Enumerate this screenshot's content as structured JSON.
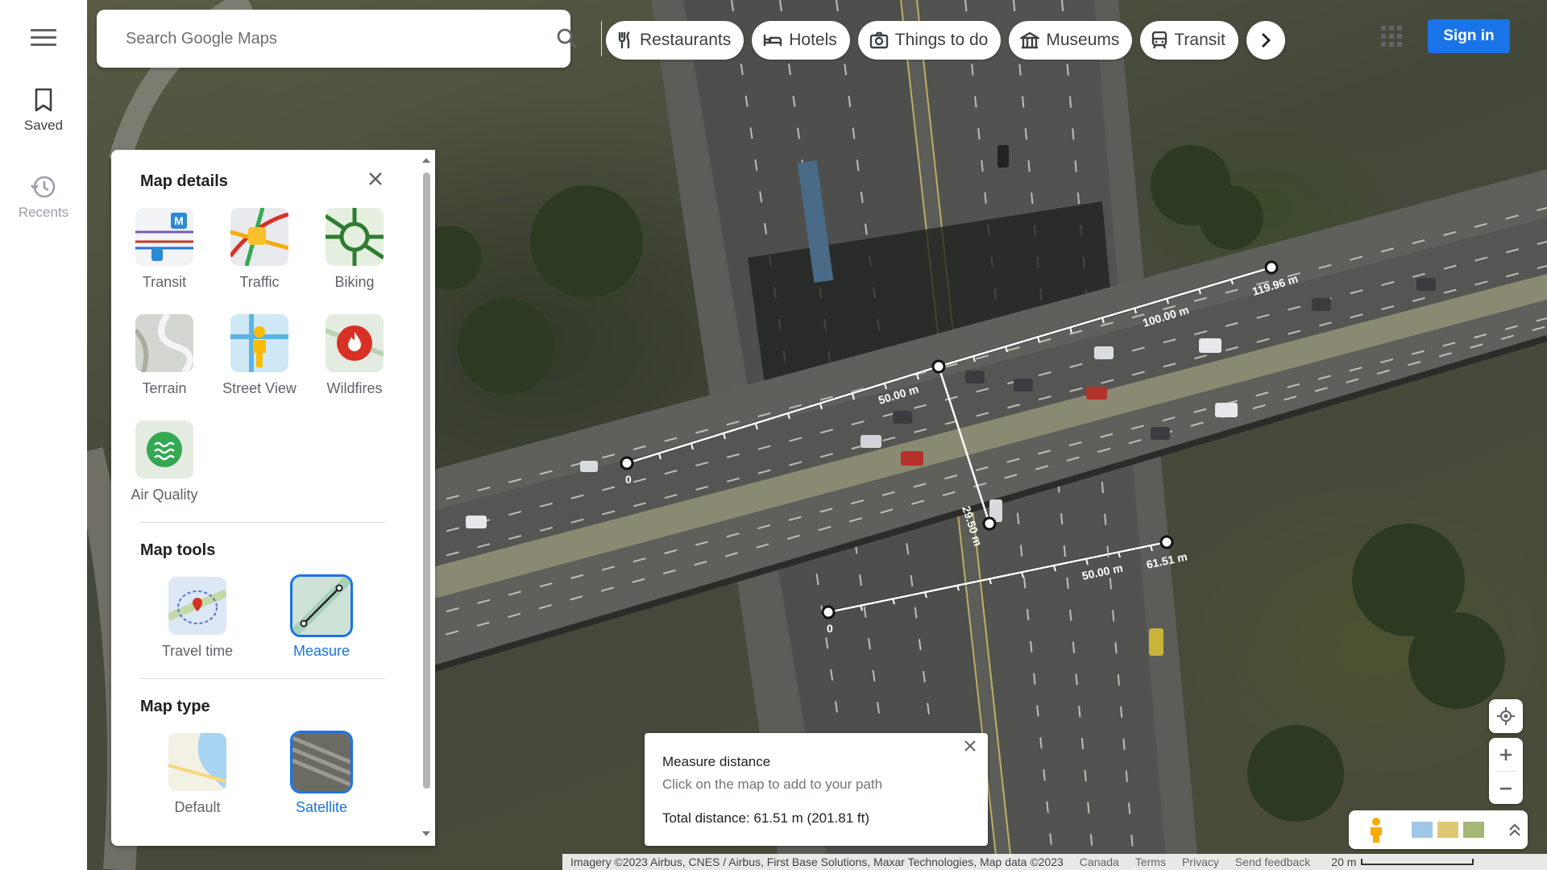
{
  "rail": {
    "saved_label": "Saved",
    "recents_label": "Recents"
  },
  "search": {
    "placeholder": "Search Google Maps"
  },
  "chips": [
    {
      "label": "Restaurants",
      "icon": "fork-knife-icon"
    },
    {
      "label": "Hotels",
      "icon": "bed-icon"
    },
    {
      "label": "Things to do",
      "icon": "camera-icon"
    },
    {
      "label": "Museums",
      "icon": "museum-icon"
    },
    {
      "label": "Transit",
      "icon": "train-icon"
    }
  ],
  "header": {
    "sign_in_label": "Sign in"
  },
  "panel": {
    "map_details_title": "Map details",
    "details": [
      {
        "label": "Transit"
      },
      {
        "label": "Traffic"
      },
      {
        "label": "Biking"
      },
      {
        "label": "Terrain"
      },
      {
        "label": "Street View"
      },
      {
        "label": "Wildfires"
      },
      {
        "label": "Air Quality"
      }
    ],
    "map_tools_title": "Map tools",
    "tools": [
      {
        "label": "Travel time"
      },
      {
        "label": "Measure",
        "selected": true
      }
    ],
    "map_type_title": "Map type",
    "types": [
      {
        "label": "Default"
      },
      {
        "label": "Satellite",
        "selected": true
      }
    ]
  },
  "measure_labels": {
    "path1": [
      "0",
      "50.00 m",
      "100.00 m",
      "119.96 m"
    ],
    "seg": "29.50 m",
    "path2": [
      "0",
      "50.00 m",
      "61.51 m"
    ]
  },
  "measure": {
    "title": "Measure distance",
    "hint": "Click on the map to add to your path",
    "total": "Total distance: 61.51 m (201.81 ft)"
  },
  "footer": {
    "imagery": "Imagery ©2023 Airbus, CNES / Airbus, First Base Solutions, Maxar Technologies, Map data ©2023",
    "country": "Canada",
    "terms": "Terms",
    "privacy": "Privacy",
    "feedback": "Send feedback",
    "scale_label": "20 m"
  },
  "colors": {
    "accent": "#1a73e8",
    "panel_bg": "#ffffff"
  }
}
